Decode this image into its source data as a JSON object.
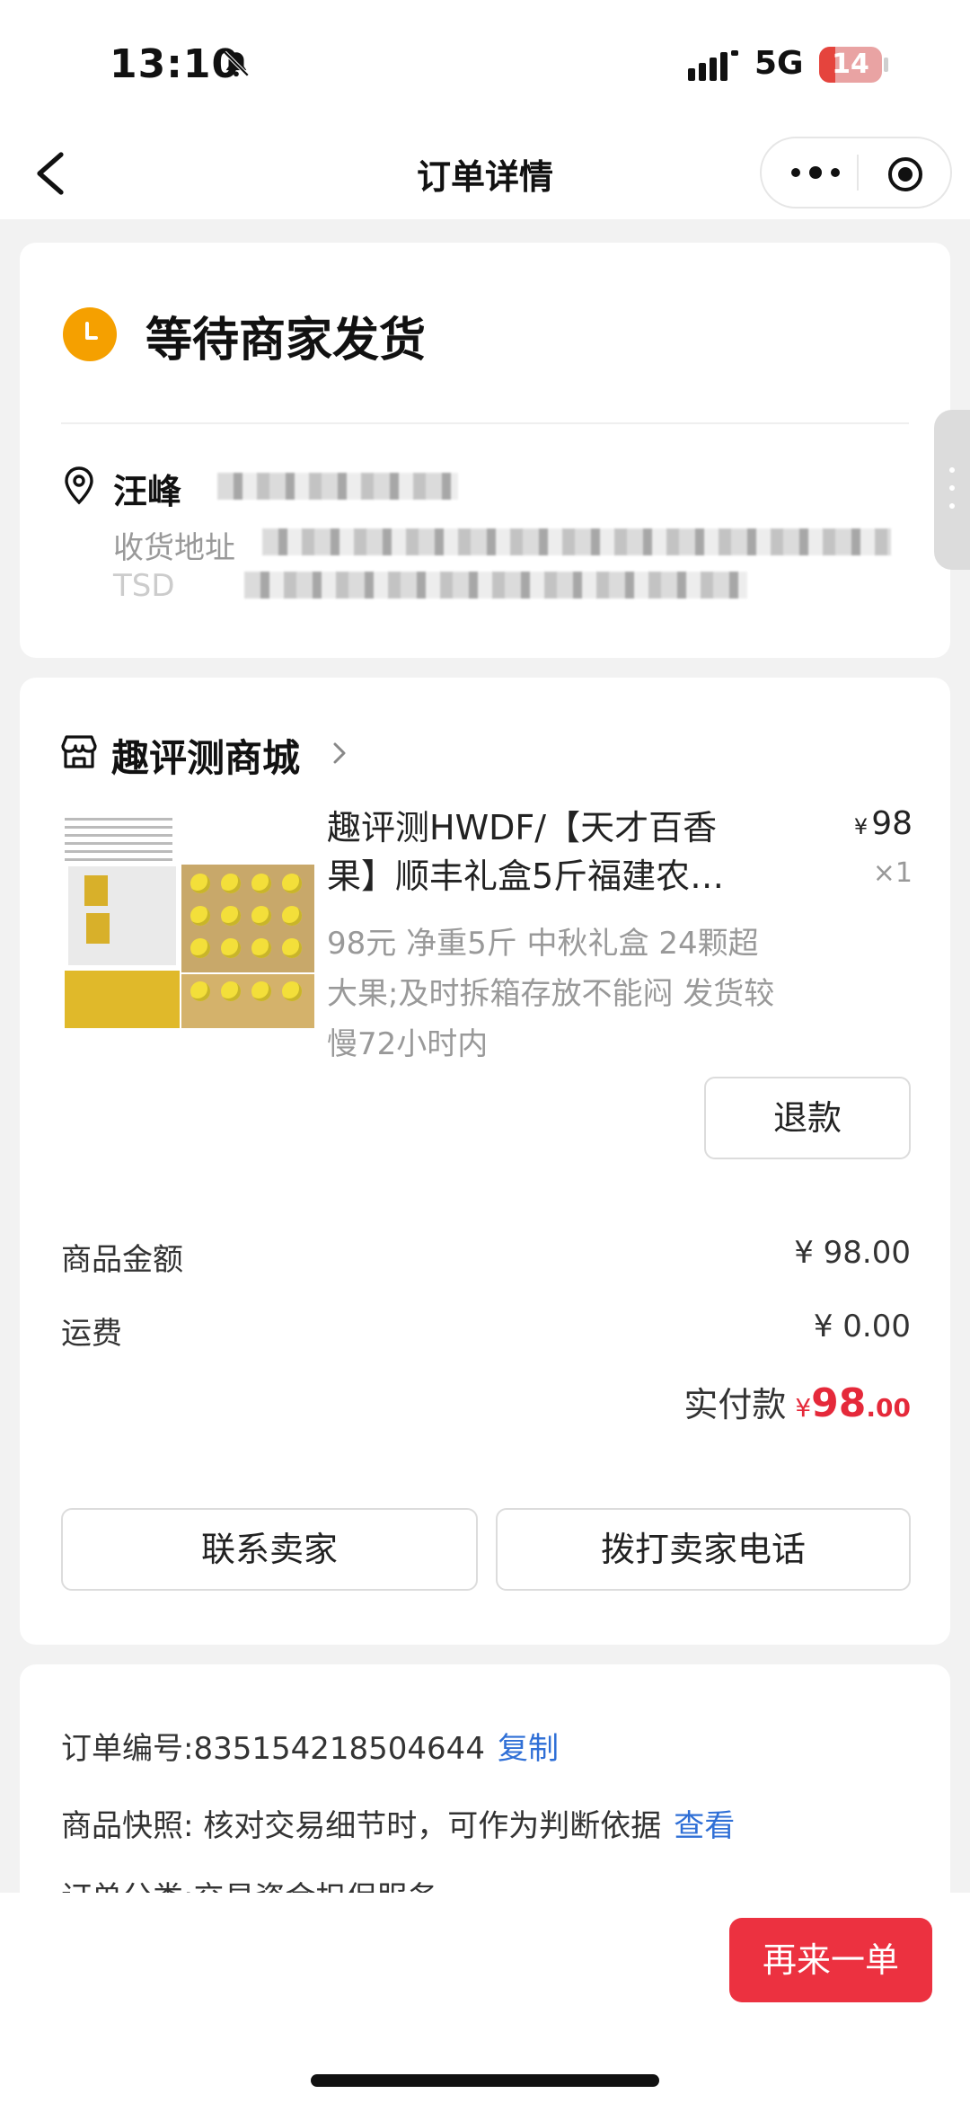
{
  "status_bar": {
    "time": "13:10",
    "network": "5G",
    "battery": "14"
  },
  "nav": {
    "title": "订单详情"
  },
  "order_status": {
    "title": "等待商家发货"
  },
  "address": {
    "name": "汪峰",
    "label": "收货地址",
    "line2": "TSD"
  },
  "store": {
    "name": "趣评测商城"
  },
  "product": {
    "title": "趣评测HWDF/【天才百香果】顺丰礼盒5斤福建农…",
    "currency": "¥",
    "price": "98",
    "qty": "×1",
    "spec": "98元 净重5斤 中秋礼盒 24颗超大果;及时拆箱存放不能闷 发货较慢72小时内",
    "refund_label": "退款"
  },
  "summary": {
    "goods_label": "商品金额",
    "goods_value": "¥ 98.00",
    "shipping_label": "运费",
    "shipping_value": "¥ 0.00",
    "paid_label": "实付款",
    "paid_currency": "¥",
    "paid_int": "98",
    "paid_dec": ".00"
  },
  "actions": {
    "contact_seller": "联系卖家",
    "call_seller": "拨打卖家电话"
  },
  "info": {
    "order_no_label": "订单编号:",
    "order_no": "835154218504644",
    "copy": "复制",
    "snapshot_label": "商品快照:",
    "snapshot_text": "核对交易细节时，可作为判断依据",
    "view": "查看",
    "category_partial": "订单分类:交易资金担保服务"
  },
  "bottom": {
    "again_label": "再来一单"
  },
  "colors": {
    "accent": "#ec3140",
    "status_icon": "#f5a000",
    "link": "#2f6fd6"
  }
}
